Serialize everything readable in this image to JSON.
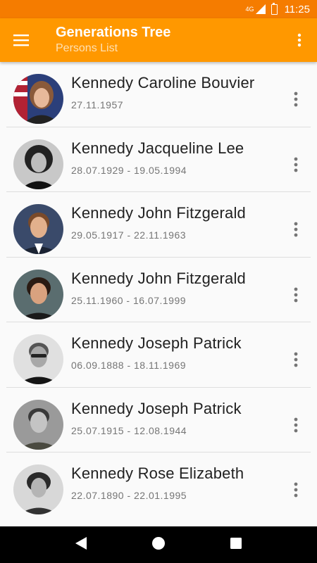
{
  "status": {
    "network": "4G",
    "time": "11:25"
  },
  "app_bar": {
    "title": "Generations Tree",
    "subtitle": "Persons List"
  },
  "persons": [
    {
      "name": "Kennedy Caroline Bouvier",
      "dates": "27.11.1957"
    },
    {
      "name": "Kennedy Jacqueline Lee",
      "dates": "28.07.1929 - 19.05.1994"
    },
    {
      "name": "Kennedy John Fitzgerald",
      "dates": "29.05.1917 - 22.11.1963"
    },
    {
      "name": "Kennedy John Fitzgerald",
      "dates": "25.11.1960 - 16.07.1999"
    },
    {
      "name": "Kennedy Joseph Patrick",
      "dates": "06.09.1888 - 18.11.1969"
    },
    {
      "name": "Kennedy Joseph Patrick",
      "dates": "25.07.1915 - 12.08.1944"
    },
    {
      "name": "Kennedy Rose Elizabeth",
      "dates": "22.07.1890 - 22.01.1995"
    }
  ],
  "colors": {
    "status_bar": "#f57c00",
    "app_bar": "#ff9800",
    "subtitle": "#ffe0b2"
  },
  "icons": {
    "menu": "menu-icon",
    "overflow": "more-vert-icon",
    "back": "back-icon",
    "home": "home-icon",
    "recents": "recents-icon"
  }
}
